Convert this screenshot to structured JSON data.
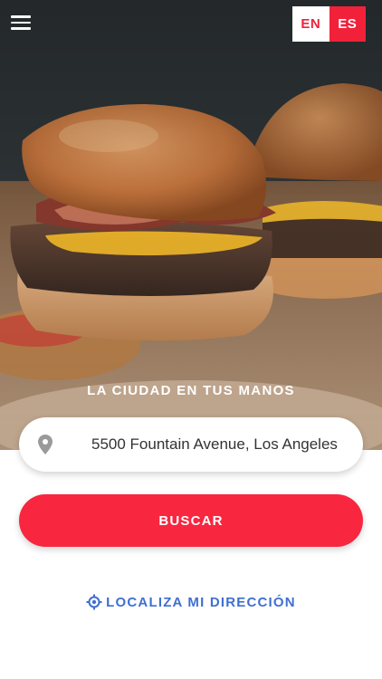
{
  "header": {
    "menu_icon": "hamburger-menu-icon",
    "languages": [
      {
        "label": "EN",
        "selected": true
      },
      {
        "label": "ES",
        "selected": false
      }
    ]
  },
  "hero": {
    "image": "burger-photo",
    "tagline": "LA CIUDAD EN TUS MANOS"
  },
  "search": {
    "icon": "location-pin-icon",
    "value": "5500 Fountain Avenue, Los Angeles"
  },
  "actions": {
    "search_label": "BUSCAR",
    "locate_label": "LOCALIZA MI DIRECCIÓN",
    "locate_icon": "crosshair-location-icon"
  },
  "colors": {
    "brand_red": "#f8263f",
    "link_blue": "#3f6fd1",
    "white": "#ffffff"
  }
}
